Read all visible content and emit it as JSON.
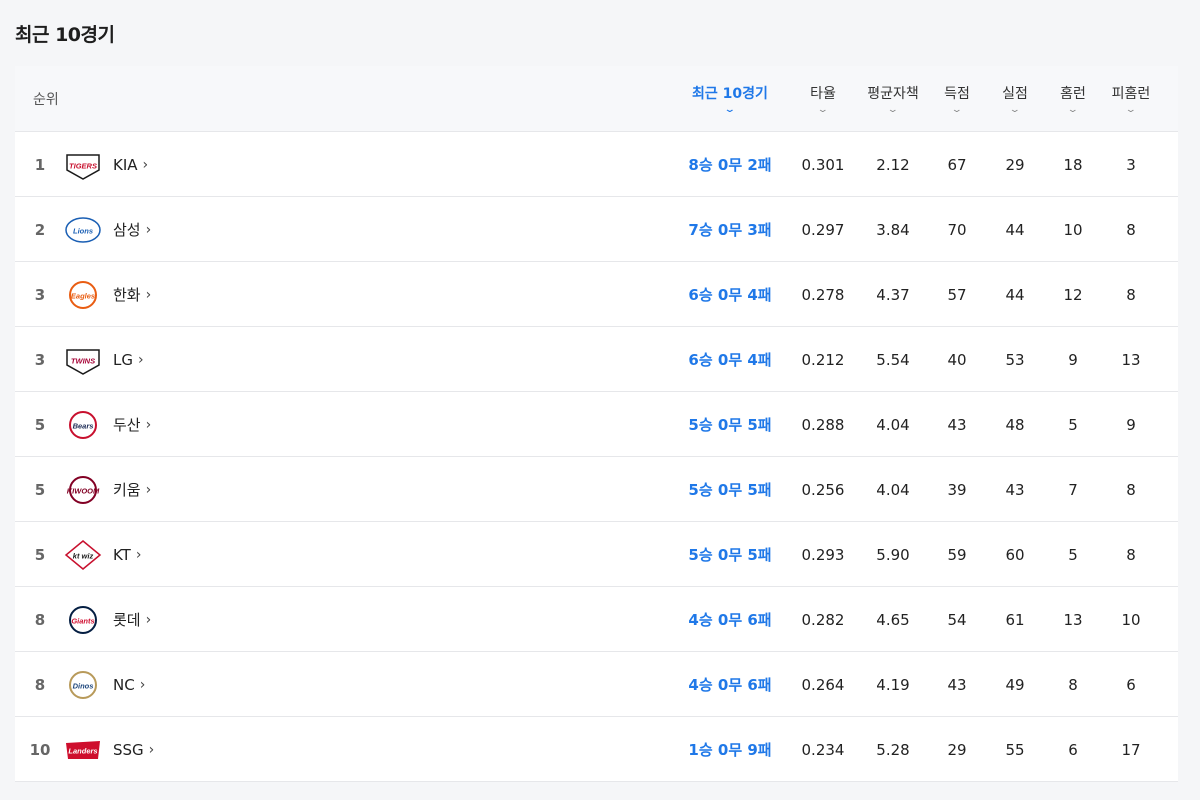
{
  "title": "최근 10경기",
  "header": {
    "rank": "순위",
    "columns": [
      {
        "key": "recent",
        "label": "최근 10경기",
        "active": true
      },
      {
        "key": "avg",
        "label": "타율"
      },
      {
        "key": "era",
        "label": "평균자책"
      },
      {
        "key": "runs",
        "label": "득점"
      },
      {
        "key": "allowed",
        "label": "실점"
      },
      {
        "key": "hr",
        "label": "홈런"
      },
      {
        "key": "hra",
        "label": "피홈런"
      }
    ],
    "chevron": "⌄"
  },
  "colors": {
    "accent": "#1f78e8"
  },
  "rows": [
    {
      "rank": "1",
      "team": "KIA",
      "logo_text": "TIGERS",
      "logo_icon": "tigers-logo-icon",
      "recent": "8승 0무 2패",
      "avg": "0.301",
      "era": "2.12",
      "runs": "67",
      "allowed": "29",
      "hr": "18",
      "hra": "3"
    },
    {
      "rank": "2",
      "team": "삼성",
      "logo_text": "Lions",
      "logo_icon": "lions-logo-icon",
      "recent": "7승 0무 3패",
      "avg": "0.297",
      "era": "3.84",
      "runs": "70",
      "allowed": "44",
      "hr": "10",
      "hra": "8"
    },
    {
      "rank": "3",
      "team": "한화",
      "logo_text": "Eagles",
      "logo_icon": "eagles-logo-icon",
      "recent": "6승 0무 4패",
      "avg": "0.278",
      "era": "4.37",
      "runs": "57",
      "allowed": "44",
      "hr": "12",
      "hra": "8"
    },
    {
      "rank": "3",
      "team": "LG",
      "logo_text": "TWINS",
      "logo_icon": "twins-logo-icon",
      "recent": "6승 0무 4패",
      "avg": "0.212",
      "era": "5.54",
      "runs": "40",
      "allowed": "53",
      "hr": "9",
      "hra": "13"
    },
    {
      "rank": "5",
      "team": "두산",
      "logo_text": "Bears",
      "logo_icon": "bears-logo-icon",
      "recent": "5승 0무 5패",
      "avg": "0.288",
      "era": "4.04",
      "runs": "43",
      "allowed": "48",
      "hr": "5",
      "hra": "9"
    },
    {
      "rank": "5",
      "team": "키움",
      "logo_text": "KIWOOM",
      "logo_icon": "kiwoom-logo-icon",
      "recent": "5승 0무 5패",
      "avg": "0.256",
      "era": "4.04",
      "runs": "39",
      "allowed": "43",
      "hr": "7",
      "hra": "8"
    },
    {
      "rank": "5",
      "team": "KT",
      "logo_text": "kt wiz",
      "logo_icon": "ktwiz-logo-icon",
      "recent": "5승 0무 5패",
      "avg": "0.293",
      "era": "5.90",
      "runs": "59",
      "allowed": "60",
      "hr": "5",
      "hra": "8"
    },
    {
      "rank": "8",
      "team": "롯데",
      "logo_text": "Giants",
      "logo_icon": "giants-logo-icon",
      "recent": "4승 0무 6패",
      "avg": "0.282",
      "era": "4.65",
      "runs": "54",
      "allowed": "61",
      "hr": "13",
      "hra": "10"
    },
    {
      "rank": "8",
      "team": "NC",
      "logo_text": "Dinos",
      "logo_icon": "dinos-logo-icon",
      "recent": "4승 0무 6패",
      "avg": "0.264",
      "era": "4.19",
      "runs": "43",
      "allowed": "49",
      "hr": "8",
      "hra": "6"
    },
    {
      "rank": "10",
      "team": "SSG",
      "logo_text": "Landers",
      "logo_icon": "landers-logo-icon",
      "recent": "1승 0무 9패",
      "avg": "0.234",
      "era": "5.28",
      "runs": "29",
      "allowed": "55",
      "hr": "6",
      "hra": "17"
    }
  ],
  "team_arrow": "›"
}
